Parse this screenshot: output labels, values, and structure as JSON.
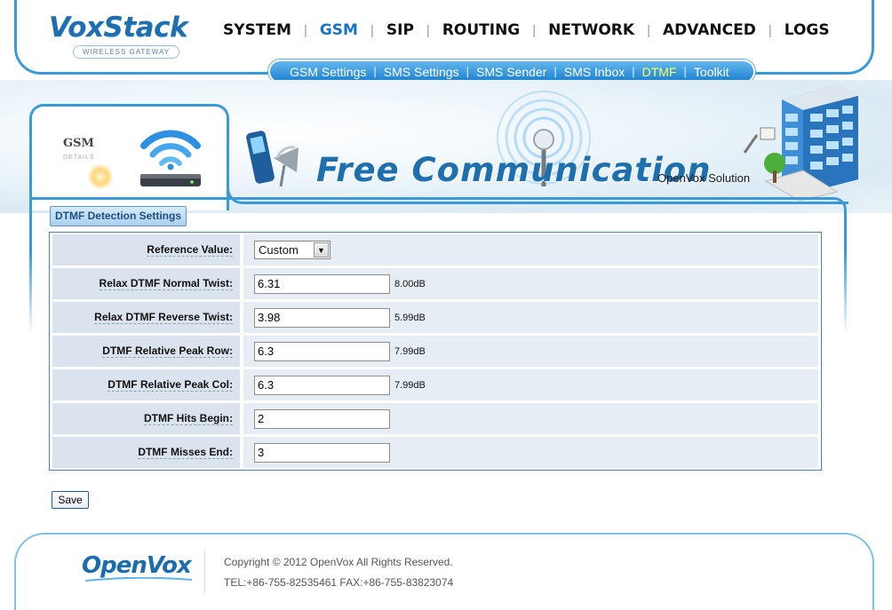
{
  "header": {
    "logo_text": "VoxStack",
    "logo_tagline": "WIRELESS GATEWAY",
    "nav": [
      {
        "label": "SYSTEM"
      },
      {
        "label": "GSM"
      },
      {
        "label": "SIP"
      },
      {
        "label": "ROUTING"
      },
      {
        "label": "NETWORK"
      },
      {
        "label": "ADVANCED"
      },
      {
        "label": "LOGS"
      }
    ],
    "active_nav": "GSM",
    "subnav": [
      {
        "label": "GSM Settings"
      },
      {
        "label": "SMS Settings"
      },
      {
        "label": "SMS Sender"
      },
      {
        "label": "SMS Inbox"
      },
      {
        "label": "DTMF"
      },
      {
        "label": "Toolkit"
      }
    ],
    "active_subnav": "DTMF"
  },
  "banner": {
    "module_title": "GSM",
    "module_subtitle": "DETAILS",
    "headline": "Free Communication",
    "headline_sub": "OpenVox Solution"
  },
  "section": {
    "title": "DTMF Detection Settings"
  },
  "settings": {
    "reference_value": {
      "label": "Reference Value:",
      "selected": "Custom"
    },
    "rows": [
      {
        "label": "Relax DTMF Normal Twist:",
        "value": "6.31",
        "unit": "8.00dB"
      },
      {
        "label": "Relax DTMF Reverse Twist:",
        "value": "3.98",
        "unit": "5.99dB"
      },
      {
        "label": "DTMF Relative Peak Row:",
        "value": "6.3",
        "unit": "7.99dB"
      },
      {
        "label": "DTMF Relative Peak Col:",
        "value": "6.3",
        "unit": "7.99dB"
      },
      {
        "label": "DTMF Hits Begin:",
        "value": "2",
        "unit": ""
      },
      {
        "label": "DTMF Misses End:",
        "value": "3",
        "unit": ""
      }
    ]
  },
  "actions": {
    "save_label": "Save"
  },
  "footer": {
    "logo_text": "OpenVox",
    "copyright": "Copyright © 2012 OpenVox All Rights Reserved.",
    "contact": "TEL:+86-755-82535461 FAX:+86-755-83823074"
  },
  "colors": {
    "accent": "#3a9ad9",
    "active_nav": "#1a73c4",
    "active_subnav": "#ffff66",
    "label_cell": "#dbe3ee",
    "value_cell": "#e6edf5"
  }
}
